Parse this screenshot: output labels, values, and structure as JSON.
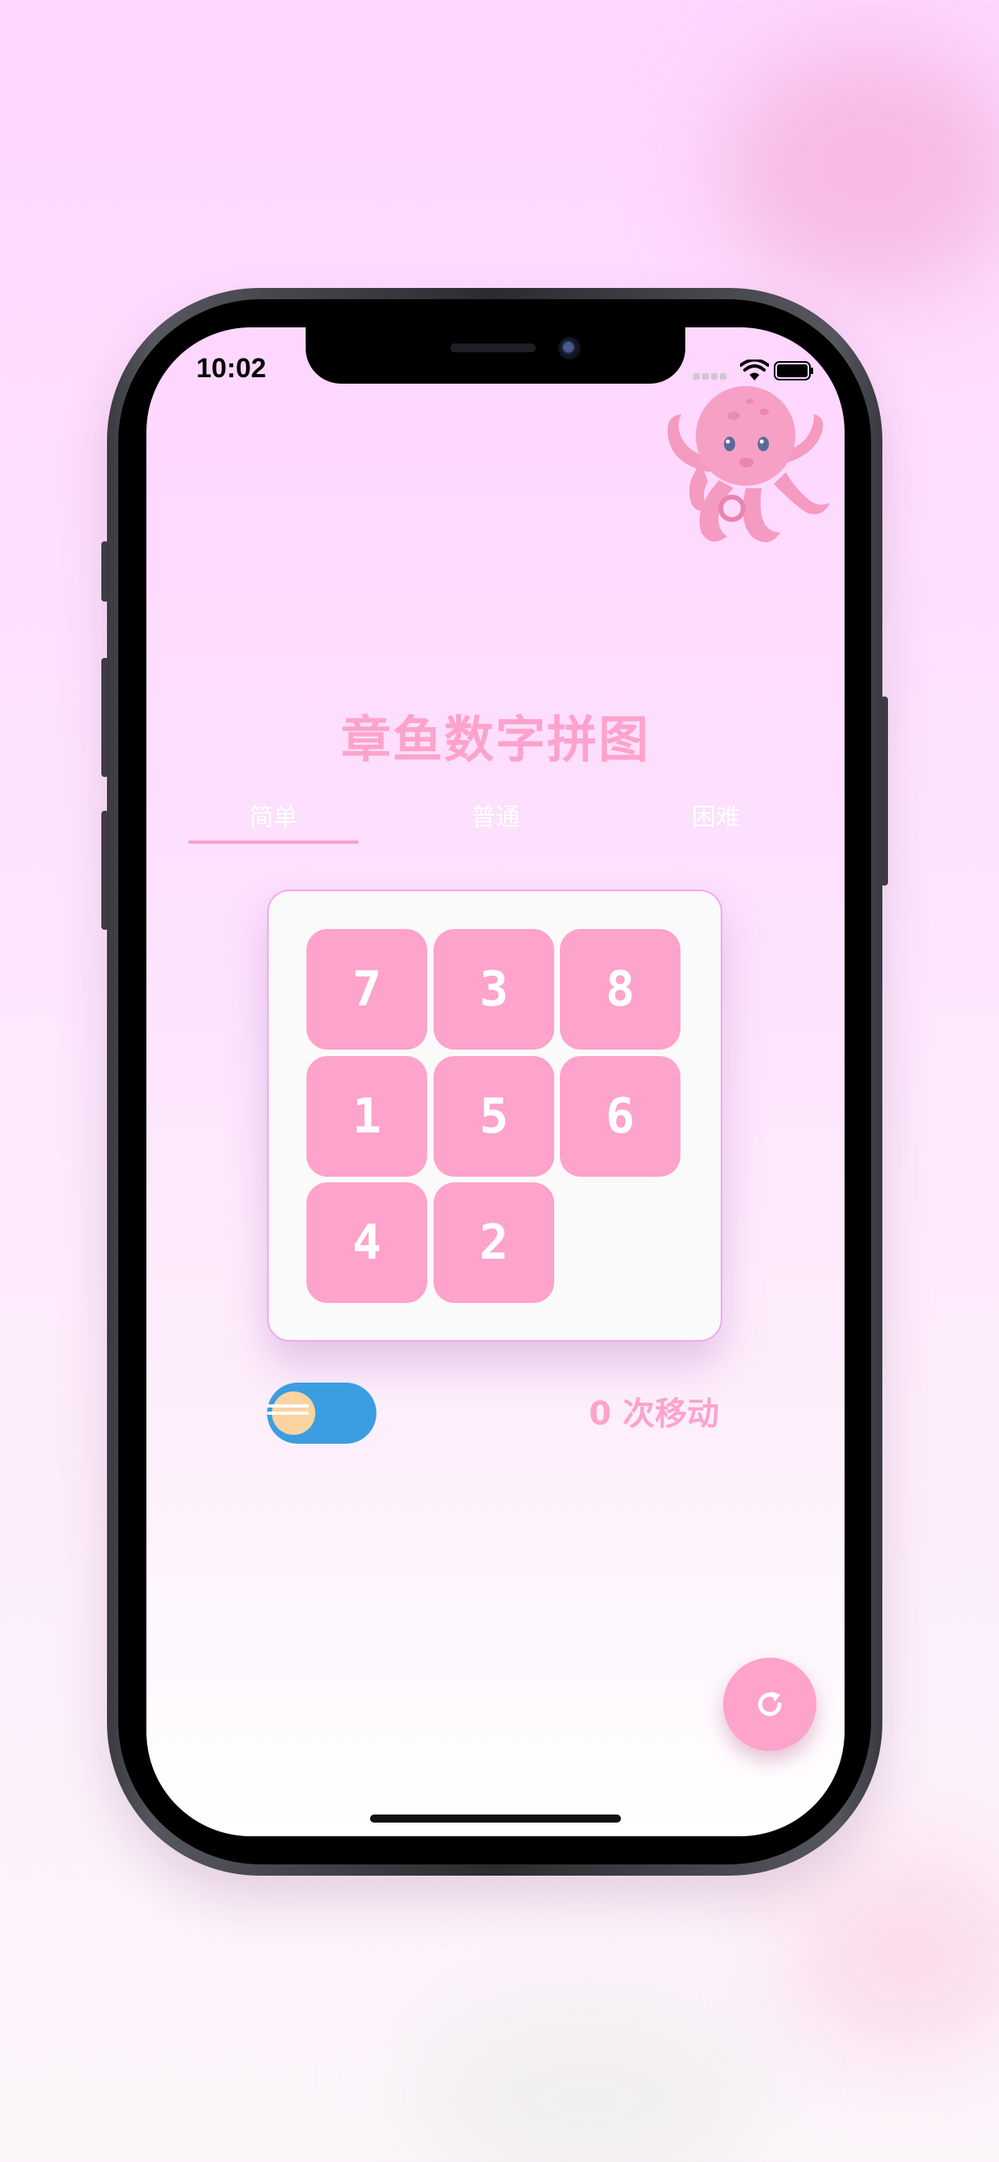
{
  "status_bar": {
    "time": "10:02",
    "wifi_icon": "wifi-icon",
    "battery_icon": "battery-icon"
  },
  "app": {
    "title": "章鱼数字拼图",
    "mascot": "octopus-illustration"
  },
  "tabs": [
    {
      "label": "简单",
      "selected": true
    },
    {
      "label": "普通",
      "selected": false
    },
    {
      "label": "困难",
      "selected": false
    }
  ],
  "board": {
    "size": 3,
    "tiles": [
      "7",
      "3",
      "8",
      "1",
      "5",
      "6",
      "4",
      "2",
      ""
    ]
  },
  "controls": {
    "toggle_on": true,
    "moves_text": "0 次移动",
    "refresh_icon": "refresh-icon"
  },
  "colors": {
    "accent_pink": "#fea3cb",
    "toggle_blue": "#3b9ee0",
    "board_border": "#f5a6ef"
  }
}
